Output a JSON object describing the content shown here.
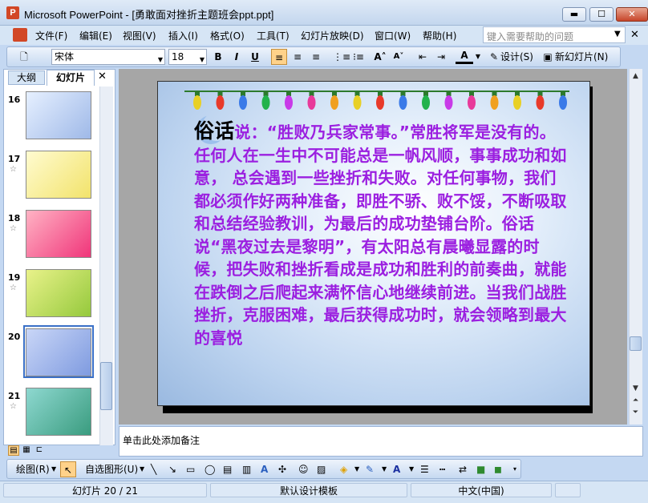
{
  "window": {
    "app_name": "Microsoft PowerPoint",
    "title": "Microsoft PowerPoint - [勇敢面对挫折主题班会ppt.ppt]",
    "min": "▬",
    "max": "☐",
    "close": "✕"
  },
  "menu": {
    "items": [
      "文件(F)",
      "编辑(E)",
      "视图(V)",
      "插入(I)",
      "格式(O)",
      "工具(T)",
      "幻灯片放映(D)",
      "窗口(W)",
      "帮助(H)"
    ],
    "help_placeholder": "键入需要帮助的问题"
  },
  "toolbar": {
    "font_name": "宋体",
    "font_size": "18",
    "bold": "B",
    "italic": "I",
    "underline": "U",
    "design_label": "设计(S)",
    "new_slide_label": "新幻灯片(N)"
  },
  "left_pane": {
    "tab_outline": "大纲",
    "tab_slides": "幻灯片",
    "close": "✕",
    "slides": [
      {
        "num": "16",
        "has_star": false
      },
      {
        "num": "17",
        "has_star": true
      },
      {
        "num": "18",
        "has_star": true
      },
      {
        "num": "19",
        "has_star": true
      },
      {
        "num": "20",
        "has_star": false,
        "selected": true
      },
      {
        "num": "21",
        "has_star": true
      }
    ]
  },
  "slide": {
    "lead": "俗话",
    "body": "说：“胜败乃兵家常事。”常胜将军是没有的。任何人在一生中不可能总是一帆风顺，事事成功和如意， 总会遇到一些挫折和失败。对任何事物，我们都必须作好两种准备，即胜不骄、败不馁，不断吸取和总结经验教训，为最后的成功垫铺台阶。俗话说“黑夜过去是黎明”，有太阳总有晨曦显露的时候，把失败和挫折看成是成功和胜利的前奏曲，就能在跌倒之后爬起来满怀信心地继续前进。当我们战胜挫折，克服困难，最后获得成功时，就会领略到最大的喜悦"
  },
  "notes": {
    "placeholder": "单击此处添加备注"
  },
  "drawing_toolbar": {
    "draw_label": "绘图(R)",
    "autoshapes_label": "自选图形(U)"
  },
  "status": {
    "slide_info": "幻灯片 20 / 21",
    "template": "默认设计模板",
    "language": "中文(中国)"
  },
  "colors": {
    "slide_text": "#9b1fe0",
    "accent": "#ffd28a"
  }
}
